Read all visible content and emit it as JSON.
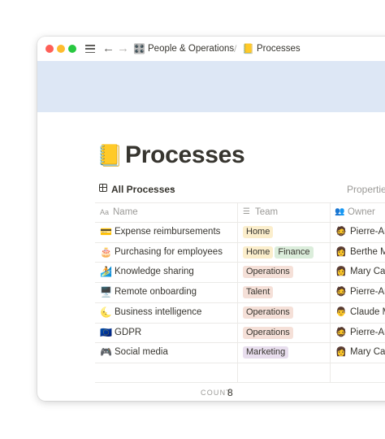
{
  "breadcrumb": {
    "workspace_icon": "🎛️",
    "workspace": "People & Operations",
    "separator": "/",
    "page_icon": "📒",
    "page": "Processes"
  },
  "nav": {
    "back": "←",
    "forward": "→"
  },
  "page": {
    "icon": "📒",
    "title": "Processes"
  },
  "view": {
    "label": "All Processes",
    "properties_label": "Properties"
  },
  "columns": [
    {
      "label": "Name",
      "icon": "Aa"
    },
    {
      "label": "Team",
      "icon": "☰"
    },
    {
      "label": "Owner",
      "icon": "👥"
    }
  ],
  "rows": [
    {
      "icon": "💳",
      "name": "Expense reimbursements",
      "teams": [
        {
          "label": "Home",
          "color": "#fbeecc"
        }
      ],
      "owner_icon": "🧔",
      "owner": "Pierre-Ar"
    },
    {
      "icon": "🎂",
      "name": "Purchasing for employees",
      "teams": [
        {
          "label": "Home",
          "color": "#fbeecc"
        },
        {
          "label": "Finance",
          "color": "#dbeddb"
        }
      ],
      "owner_icon": "👩",
      "owner": "Berthe M"
    },
    {
      "icon": "🏄",
      "name": "Knowledge sharing",
      "teams": [
        {
          "label": "Operations",
          "color": "#f5e0d8"
        }
      ],
      "owner_icon": "👩",
      "owner": "Mary Cas"
    },
    {
      "icon": "🖥️",
      "name": "Remote onboarding",
      "teams": [
        {
          "label": "Talent",
          "color": "#f5e0d8"
        }
      ],
      "owner_icon": "🧔",
      "owner": "Pierre-Ar"
    },
    {
      "icon": "🌜",
      "name": "Business intelligence",
      "teams": [
        {
          "label": "Operations",
          "color": "#f5e0d8"
        }
      ],
      "owner_icon": "👨",
      "owner": "Claude M"
    },
    {
      "icon": "🇪🇺",
      "name": "GDPR",
      "teams": [
        {
          "label": "Operations",
          "color": "#f5e0d8"
        }
      ],
      "owner_icon": "🧔",
      "owner": "Pierre-Ar"
    },
    {
      "icon": "🎮",
      "name": "Social media",
      "teams": [
        {
          "label": "Marketing",
          "color": "#e8deee"
        }
      ],
      "owner_icon": "👩",
      "owner": "Mary Cas"
    }
  ],
  "footer": {
    "count_label": "COUNT",
    "count_value": "8"
  }
}
